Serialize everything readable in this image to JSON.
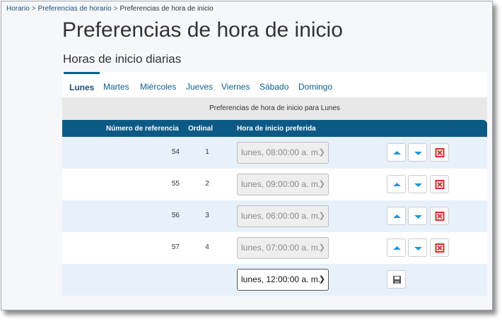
{
  "breadcrumb": {
    "items": [
      "Horario",
      "Preferencias de horario",
      "Preferencias de hora de inicio"
    ],
    "separator": ">"
  },
  "page": {
    "title": "Preferencias de hora de inicio",
    "subtitle": "Horas de inicio diarias"
  },
  "tabs": [
    {
      "label": "Lunes",
      "active": true
    },
    {
      "label": "Martes"
    },
    {
      "label": "Miércoles"
    },
    {
      "label": "Jueves"
    },
    {
      "label": "Viernes"
    },
    {
      "label": "Sábado"
    },
    {
      "label": "Domingo"
    }
  ],
  "table": {
    "caption": "Preferencias de hora de inicio para Lunes",
    "headers": {
      "reference": "Número de referencia",
      "ordinal": "Ordinal",
      "start_time": "Hora de inicio preferida"
    },
    "rows": [
      {
        "reference": "54",
        "ordinal": "1",
        "start_time": "lunes, 08:00:00 a. m."
      },
      {
        "reference": "55",
        "ordinal": "2",
        "start_time": "lunes, 09:00:00 a. m."
      },
      {
        "reference": "56",
        "ordinal": "3",
        "start_time": "lunes, 06:00:00 a. m."
      },
      {
        "reference": "57",
        "ordinal": "4",
        "start_time": "lunes, 07:00:00 a. m."
      }
    ],
    "new_row": {
      "start_time": "lunes, 12:00:00 a. m."
    }
  },
  "icons": {
    "move_up": "arrow-up-icon",
    "move_down": "arrow-down-icon",
    "delete": "delete-icon",
    "save": "save-icon"
  },
  "colors": {
    "header_bg": "#0c5985",
    "tab_text": "#0b5e8e",
    "row_alt": "#e7f1fa",
    "arrow": "#1f97d6",
    "delete": "#d0312d"
  }
}
